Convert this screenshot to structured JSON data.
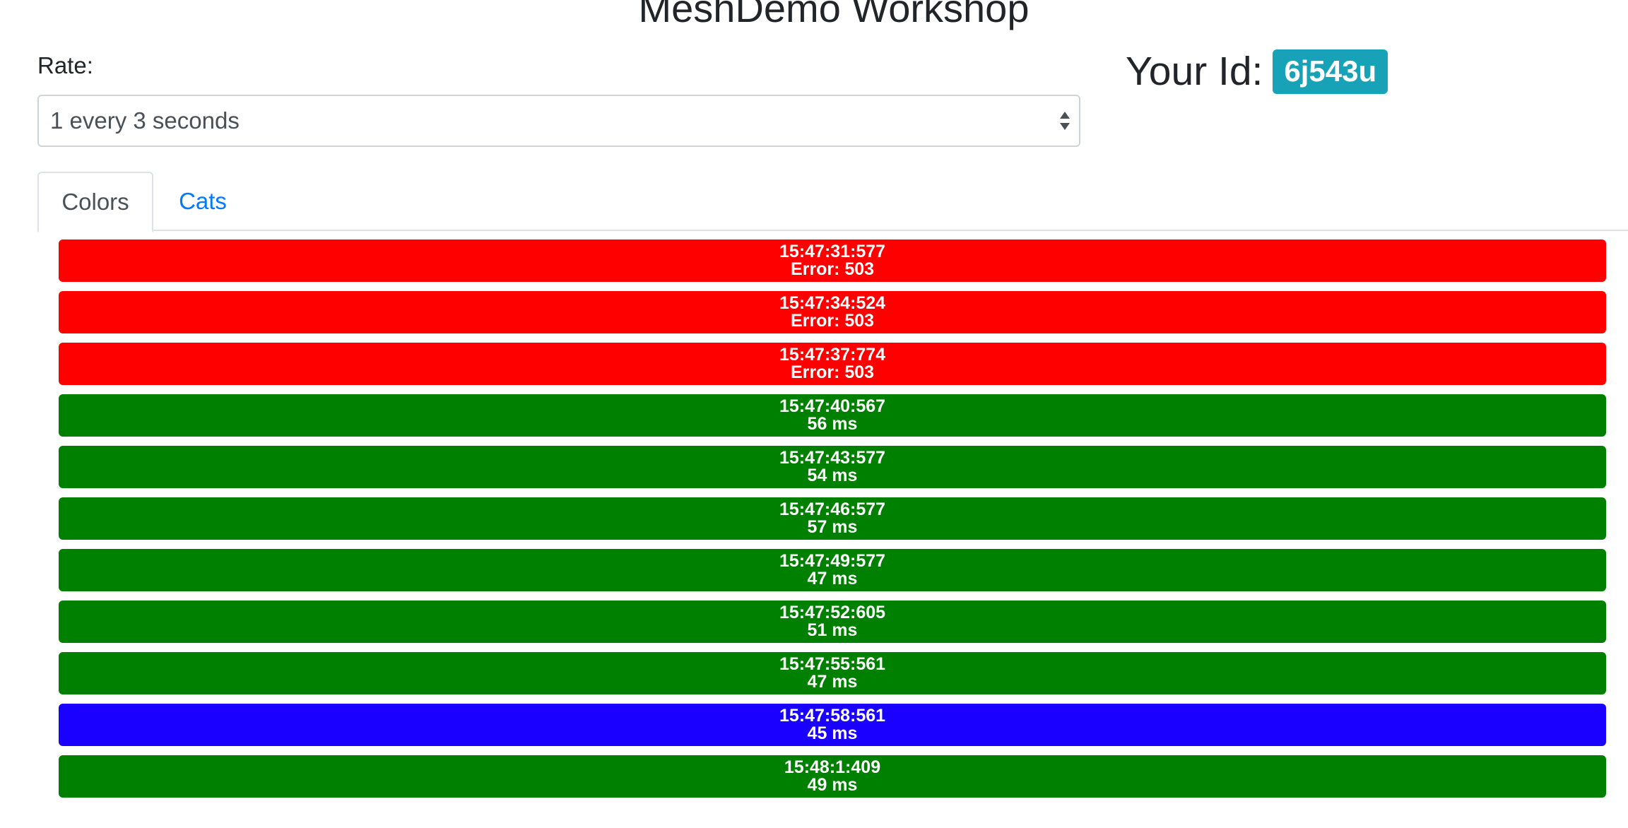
{
  "header": {
    "title": "MeshDemo Workshop"
  },
  "rate": {
    "label": "Rate:",
    "selected": "1 every 3 seconds"
  },
  "identity": {
    "label": "Your Id:",
    "id": "6j543u",
    "badge_color": "#17a2b8"
  },
  "tabs": [
    {
      "label": "Colors",
      "active": true
    },
    {
      "label": "Cats",
      "active": false
    }
  ],
  "colors": {
    "red": "#ff0000",
    "green": "#008000",
    "blue": "#1a00ff"
  },
  "results": [
    {
      "time": "15:47:31:577",
      "detail": "Error: 503",
      "color": "red"
    },
    {
      "time": "15:47:34:524",
      "detail": "Error: 503",
      "color": "red"
    },
    {
      "time": "15:47:37:774",
      "detail": "Error: 503",
      "color": "red"
    },
    {
      "time": "15:47:40:567",
      "detail": "56 ms",
      "color": "green"
    },
    {
      "time": "15:47:43:577",
      "detail": "54 ms",
      "color": "green"
    },
    {
      "time": "15:47:46:577",
      "detail": "57 ms",
      "color": "green"
    },
    {
      "time": "15:47:49:577",
      "detail": "47 ms",
      "color": "green"
    },
    {
      "time": "15:47:52:605",
      "detail": "51 ms",
      "color": "green"
    },
    {
      "time": "15:47:55:561",
      "detail": "47 ms",
      "color": "green"
    },
    {
      "time": "15:47:58:561",
      "detail": "45 ms",
      "color": "blue"
    },
    {
      "time": "15:48:1:409",
      "detail": "49 ms",
      "color": "green"
    }
  ]
}
